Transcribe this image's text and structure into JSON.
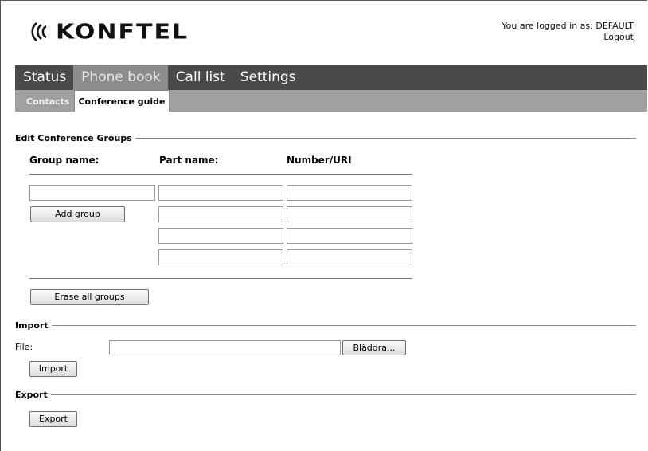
{
  "logo": {
    "text": "KONFTEL"
  },
  "header": {
    "login_text": "You are logged in as: DEFAULT",
    "logout_label": "Logout"
  },
  "mainnav": {
    "tabs": [
      {
        "label": "Status"
      },
      {
        "label": "Phone book"
      },
      {
        "label": "Call list"
      },
      {
        "label": "Settings"
      }
    ]
  },
  "subnav": {
    "tabs": [
      {
        "label": "Contacts"
      },
      {
        "label": "Conference guide"
      }
    ]
  },
  "conference": {
    "legend": "Edit Conference Groups",
    "col_group": "Group name:",
    "col_part": "Part name:",
    "col_number": "Number/URI",
    "add_group_label": "Add group",
    "erase_label": "Erase all groups"
  },
  "import": {
    "legend": "Import",
    "file_label": "File:",
    "browse_label": "Bläddra...",
    "import_label": "Import"
  },
  "export": {
    "legend": "Export",
    "export_label": "Export"
  },
  "colors": {
    "nav_bg": "#4a4a4a",
    "nav_active": "#8c8c8c",
    "subnav_bg": "#a0a0a0"
  }
}
